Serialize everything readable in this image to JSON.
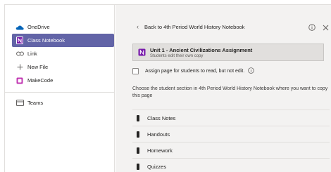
{
  "sidebar": {
    "items": [
      {
        "label": "OneDrive",
        "icon": "onedrive-icon"
      },
      {
        "label": "Class Notebook",
        "icon": "onenote-icon"
      },
      {
        "label": "Link",
        "icon": "link-icon"
      },
      {
        "label": "New File",
        "icon": "plus-icon"
      },
      {
        "label": "MakeCode",
        "icon": "makecode-icon"
      },
      {
        "label": "Teams",
        "icon": "teams-icon"
      }
    ],
    "active_index": 1
  },
  "header": {
    "back_label": "Back to 4th Period World History Notebook"
  },
  "assignment": {
    "title": "Unit 1 - Ancient Civilizations Assignment",
    "subtitle": "Students edit their own copy"
  },
  "checkbox": {
    "label": "Assign page for students to read, but not edit."
  },
  "instruction": "Choose the student section in 4th Period World History Notebook where you want to copy this page",
  "sections": [
    {
      "label": "Class Notes"
    },
    {
      "label": "Handouts"
    },
    {
      "label": "Homework"
    },
    {
      "label": "Quizzes"
    }
  ],
  "colors": {
    "accent": "#6264a7",
    "onedrive": "#0364b8",
    "onenote": "#7719aa",
    "makecode": "#c239b3"
  }
}
